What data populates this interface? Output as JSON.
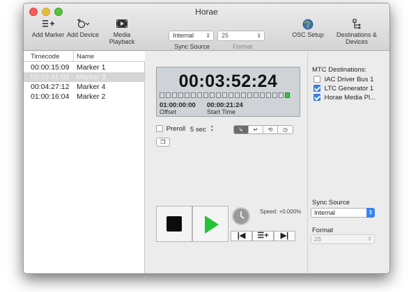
{
  "window": {
    "title": "Horae",
    "traffic": {
      "close": "#fc5b57",
      "minimize": "#e5bf3c",
      "zoom": "#57c038"
    }
  },
  "toolbar": {
    "add_marker": {
      "label": "Add Marker",
      "icon": "list-plus-icon"
    },
    "add_device": {
      "label": "Add Device",
      "icon": "device-plus-icon"
    },
    "media_playback": {
      "label": "Media Playback",
      "icon": "film-icon"
    },
    "sync_source": {
      "value": "Internal",
      "label": "Sync Source"
    },
    "format": {
      "value": "25",
      "label": "Format"
    },
    "osc_setup": {
      "label": "OSC Setup",
      "icon": "globe-icon"
    },
    "destinations": {
      "label": "Destinations & Devices",
      "icon": "network-icon"
    }
  },
  "markers": {
    "headers": {
      "timecode": "Timecode",
      "name": "Name"
    },
    "rows": [
      {
        "timecode": "00:00:15:09",
        "name": "Marker 1"
      },
      {
        "timecode": "00:03:41:03",
        "name": "Marker 3",
        "selected": true
      },
      {
        "timecode": "00:04:27:12",
        "name": "Marker 4"
      },
      {
        "timecode": "01:00:16:04",
        "name": "Marker 2"
      }
    ]
  },
  "display": {
    "timecode": "00:03:52:24",
    "offset_value": "01:00:00:00",
    "offset_label": "Offset",
    "start_value": "00:00:21:24",
    "start_label": "Start Time",
    "meter_segments": 21,
    "meter_active": 1
  },
  "controls": {
    "preroll_label": "Preroll",
    "preroll_checked": false,
    "preroll_value": "5 sec",
    "mode_buttons": [
      "loop-return-icon",
      "jump-icon",
      "cycle-icon",
      "clock-icon"
    ],
    "active_mode": 0,
    "speed_label": "Speed: +0.000%"
  },
  "mtc": {
    "title": "MTC Destinations:",
    "items": [
      {
        "name": "IAC Driver Bus 1",
        "checked": false
      },
      {
        "name": "LTC Generator 1",
        "checked": true
      },
      {
        "name": "Horae Media Pl...",
        "checked": true
      }
    ]
  },
  "right_panel": {
    "sync_source_label": "Sync Source",
    "sync_source_value": "Internal",
    "format_label": "Format",
    "format_value": "25"
  },
  "colors": {
    "accent": "#3a85f0",
    "play": "#22c433",
    "meter_on": "#2ecc40"
  }
}
